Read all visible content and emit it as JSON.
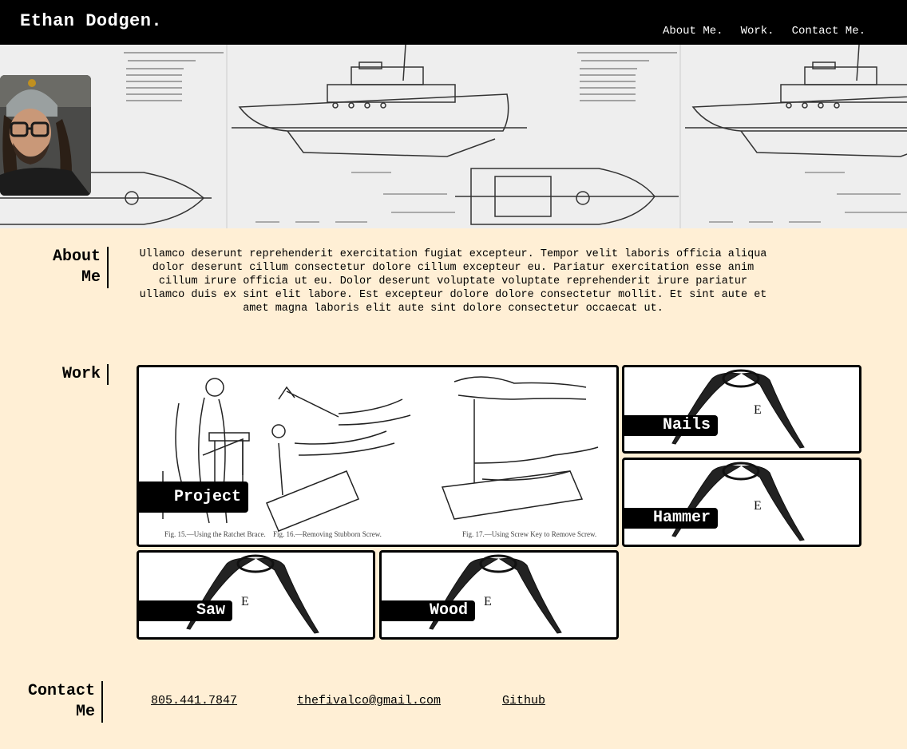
{
  "header": {
    "brand": "Ethan Dodgen.",
    "nav": [
      "About Me.",
      "Work.",
      "Contact Me."
    ]
  },
  "about": {
    "title": "About Me",
    "text": "Ullamco deserunt reprehenderit exercitation fugiat excepteur. Tempor velit laboris officia aliqua dolor deserunt cillum consectetur dolore cillum excepteur eu. Pariatur exercitation esse anim cillum irure officia ut eu. Dolor deserunt voluptate voluptate reprehenderit irure pariatur ullamco duis ex sint elit labore. Est excepteur dolore dolore consectetur mollit. Et sint aute et amet magna laboris elit aute sint dolore consectetur occaecat ut."
  },
  "work": {
    "title": "Work",
    "cards": [
      "Project",
      "Nails",
      "Hammer",
      "Saw",
      "Wood"
    ],
    "project_captions": [
      "Fig. 15.—Using the Ratchet Brace.",
      "Fig. 16.—Removing Stubborn Screw.",
      "Fig. 17.—Using Screw Key to Remove Screw."
    ],
    "compass_letter": "E"
  },
  "contact": {
    "title": "Contact Me",
    "phone": "805.441.7847",
    "email": "thefivalco@gmail.com",
    "github": "Github"
  },
  "colors": {
    "background": "#ffefd5",
    "header": "#000000",
    "accent_text": "#ffffff"
  },
  "icons": [
    "profile-photo",
    "boat-blueprint-image",
    "tools-illustration-image",
    "compass-illustration-image"
  ]
}
